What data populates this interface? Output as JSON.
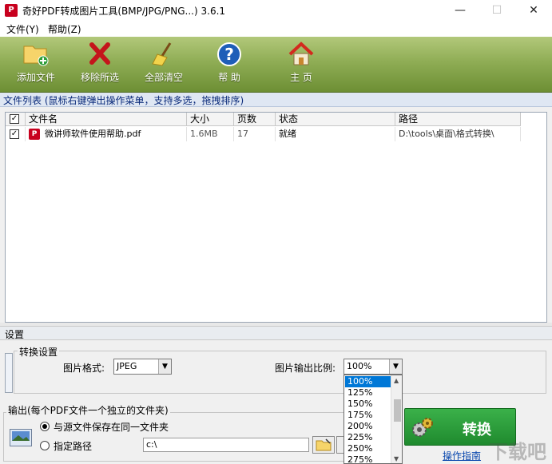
{
  "window": {
    "title": "奇好PDF转成图片工具(BMP/JPG/PNG...) 3.6.1",
    "controls": {
      "minimize": "—",
      "maximize": "☐",
      "close": "✕"
    }
  },
  "menu": {
    "file": "文件(Y)",
    "help": "帮助(Z)"
  },
  "toolbar": {
    "add_file": "添加文件",
    "remove_selected": "移除所选",
    "clear_all": "全部清空",
    "help": "帮 助",
    "home": "主 页"
  },
  "file_list": {
    "header": "文件列表   (鼠标右键弹出操作菜单，支持多选，拖拽排序)",
    "columns": {
      "check": "✓",
      "name": "文件名",
      "size": "大小",
      "pages": "页数",
      "status": "状态",
      "path": "路径"
    },
    "rows": [
      {
        "checked": "✓",
        "name": "微讲师软件使用帮助.pdf",
        "size": "1.6MB",
        "pages": "17",
        "status": "就绪",
        "path": "D:\\tools\\桌面\\格式转换\\"
      }
    ]
  },
  "settings": {
    "header": "设置",
    "conversion": {
      "group_title": "转换设置",
      "format_label": "图片格式:",
      "format_value": "JPEG",
      "scale_label": "图片输出比例:",
      "scale_value": "100%",
      "scale_options": [
        "100%",
        "125%",
        "150%",
        "175%",
        "200%",
        "225%",
        "250%",
        "275%"
      ]
    },
    "output": {
      "group_title": "输出(每个PDF文件一个独立的文件夹)",
      "same_folder_label": "与源文件保存在同一文件夹",
      "custom_path_label": "指定路径",
      "path_value": "c:\\"
    }
  },
  "actions": {
    "convert": "转换",
    "guide": "操作指南"
  },
  "watermark": "下载吧",
  "colors": {
    "toolbar_green": "#8fad55",
    "convert_green": "#2a9b3a",
    "selection_blue": "#0078d7"
  }
}
